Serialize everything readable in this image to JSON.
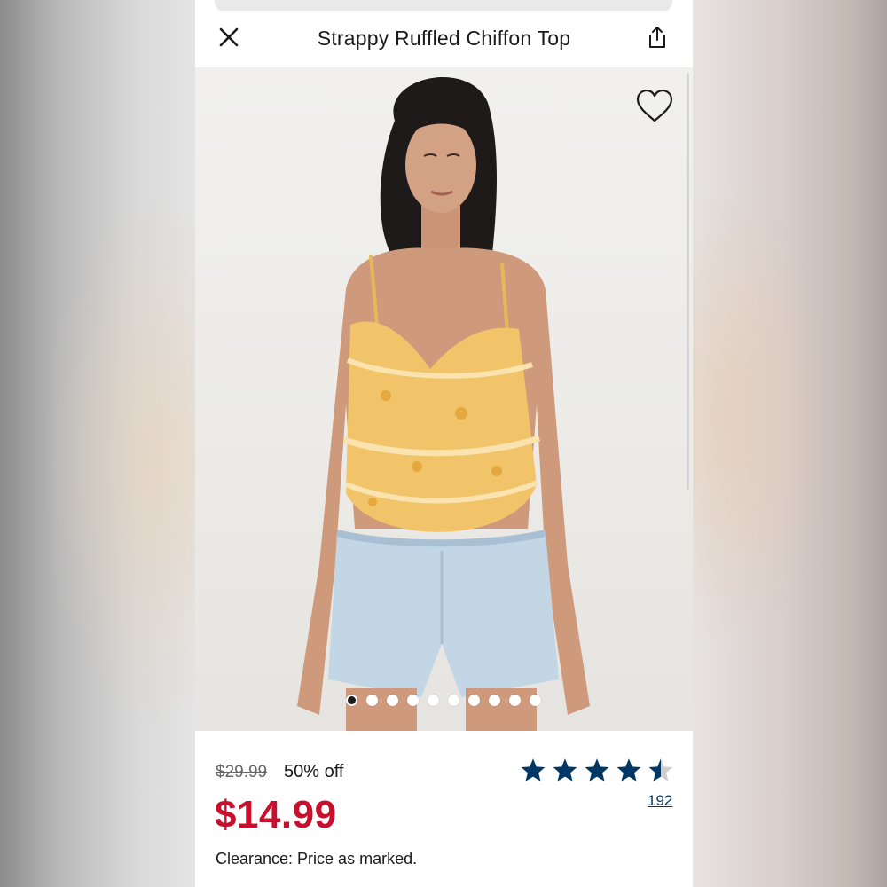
{
  "header": {
    "title": "Strappy Ruffled Chiffon Top",
    "close_icon": "close-icon",
    "share_icon": "share-icon"
  },
  "gallery": {
    "favorite_icon": "heart-outline-icon",
    "image_count": 10,
    "active_index": 0
  },
  "pricing": {
    "original_price": "$29.99",
    "discount": "50% off",
    "sale_price": "$14.99",
    "clearance_note": "Clearance: Price as marked."
  },
  "rating": {
    "stars": 4.5,
    "max": 5,
    "review_count": "192"
  },
  "colors": {
    "sale_red": "#c8102e",
    "star_navy": "#003764",
    "top_yellow": "#f2c46a"
  }
}
